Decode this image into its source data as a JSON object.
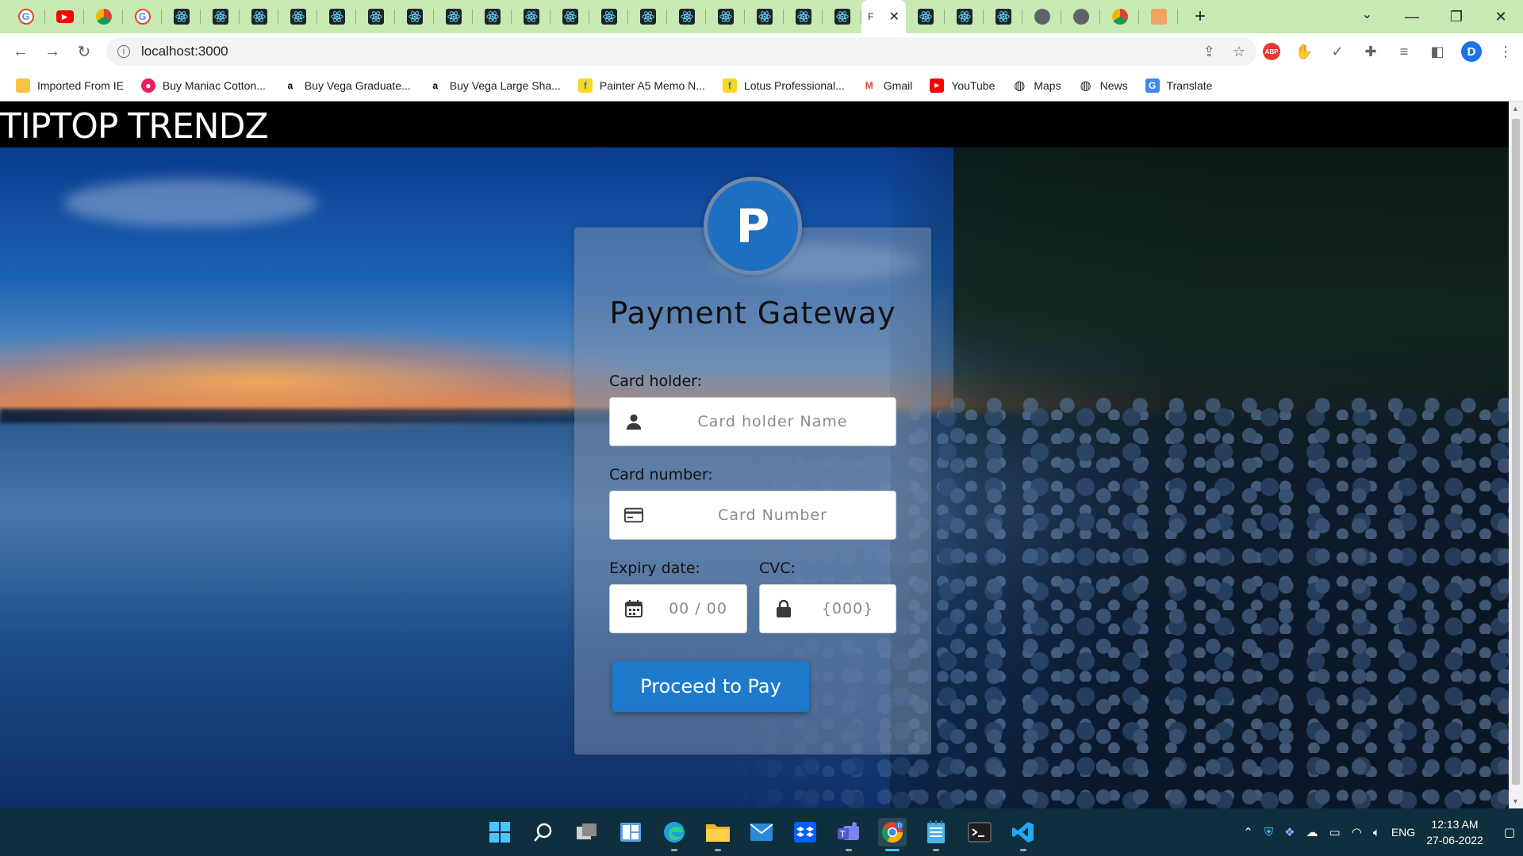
{
  "browser": {
    "active_tab_title": "F",
    "url": "localhost:3000",
    "profile_initial": "D",
    "abp_label": "ABP"
  },
  "bookmarks": [
    {
      "label": "Imported From IE",
      "icon": "folder-icon",
      "color": "#f6c344"
    },
    {
      "label": "Buy Maniac Cotton...",
      "icon": "shop-icon",
      "color": "#e91e63"
    },
    {
      "label": "Buy Vega Graduate...",
      "icon": "amazon-icon",
      "color": "#000000"
    },
    {
      "label": "Buy Vega Large Sha...",
      "icon": "amazon-icon",
      "color": "#000000"
    },
    {
      "label": "Painter A5 Memo N...",
      "icon": "flipkart-icon",
      "color": "#f9d71c"
    },
    {
      "label": "Lotus Professional...",
      "icon": "flipkart-icon",
      "color": "#f9d71c"
    },
    {
      "label": "Gmail",
      "icon": "gmail-icon",
      "color": "#ea4335"
    },
    {
      "label": "YouTube",
      "icon": "youtube-icon",
      "color": "#ff0000"
    },
    {
      "label": "Maps",
      "icon": "globe-icon",
      "color": "#202124"
    },
    {
      "label": "News",
      "icon": "globe-icon",
      "color": "#202124"
    },
    {
      "label": "Translate",
      "icon": "translate-icon",
      "color": "#4285f4"
    }
  ],
  "site": {
    "brand": "TIPTOP TRENDZ"
  },
  "payment": {
    "logo_letter": "P",
    "title": "Payment Gateway",
    "card_holder_label": "Card holder:",
    "card_holder_placeholder": "Card holder Name",
    "card_number_label": "Card number:",
    "card_number_placeholder": "Card Number",
    "expiry_label": "Expiry date:",
    "expiry_placeholder": "00 / 00",
    "cvc_label": "CVC:",
    "cvc_placeholder": "{000}",
    "submit_label": "Proceed to Pay",
    "accent_color": "#1f7acb"
  },
  "taskbar": {
    "language": "ENG",
    "time": "12:13 AM",
    "date": "27-06-2022"
  }
}
